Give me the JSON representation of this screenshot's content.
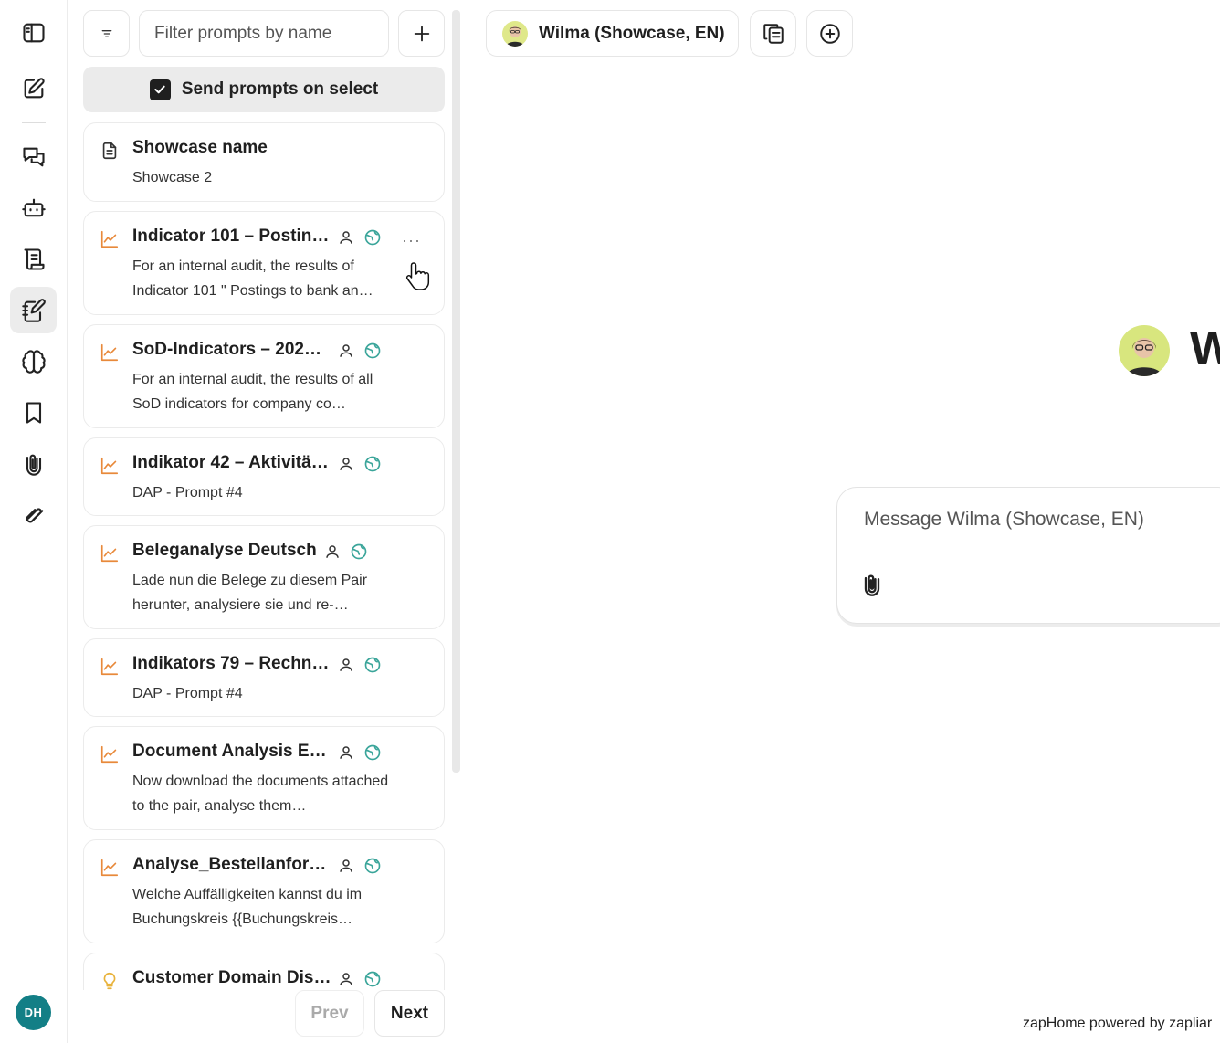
{
  "rail": {
    "items": [
      {
        "name": "sidebar-toggle"
      },
      {
        "name": "new-chat"
      },
      {
        "name": "chats"
      },
      {
        "name": "agents"
      },
      {
        "name": "documents"
      },
      {
        "name": "prompts"
      },
      {
        "name": "knowledge"
      },
      {
        "name": "bookmarks"
      },
      {
        "name": "attachments"
      },
      {
        "name": "files"
      }
    ],
    "user_initials": "DH"
  },
  "prompts_panel": {
    "filter_placeholder": "Filter prompts by name",
    "send_on_select_label": "Send prompts on select",
    "send_on_select_checked": true,
    "cards": [
      {
        "icon": "document-icon",
        "title": "Showcase name",
        "description": "Showcase 2"
      },
      {
        "icon": "chart-icon",
        "title": "Indicator 101 – Postin…",
        "description": "For an internal audit, the results of Indicator 101 \" Postings to bank an…",
        "more": "···"
      },
      {
        "icon": "chart-icon",
        "title": "SoD-Indicators – 202…",
        "description": "For an internal audit, the results of all SoD indicators for company co…"
      },
      {
        "icon": "chart-icon",
        "title": "Indikator 42 – Aktivitä…",
        "description": "DAP - Prompt #4"
      },
      {
        "icon": "chart-icon",
        "title": "Beleganalyse Deutsch",
        "description": "Lade nun die Belege zu diesem Pair herunter, analysiere sie und re-…"
      },
      {
        "icon": "chart-icon",
        "title": "Indikators 79 – Rechn…",
        "description": "DAP - Prompt #4"
      },
      {
        "icon": "chart-icon",
        "title": "Document Analysis E…",
        "description": "Now download the documents attached to the pair, analyse them…"
      },
      {
        "icon": "chart-icon",
        "title": "Analyse_Bestellanfor…",
        "description": "Welche Auffälligkeiten kannst du im Buchungskreis {{Buchungskreis…"
      },
      {
        "icon": "lightbulb-icon",
        "title": "Customer Domain Dis…",
        "description": ""
      }
    ],
    "pager": {
      "prev": "Prev",
      "next": "Next"
    }
  },
  "chat": {
    "agent_name": "Wilma (Showcase, EN)",
    "big_initial": "W",
    "message_placeholder": "Message Wilma (Showcase, EN)"
  },
  "footer": "zapHome powered by zapliar",
  "colors": {
    "accent_orange": "#e8893a",
    "globe_teal": "#3aa59a",
    "avatar_bg": "#137f86"
  }
}
